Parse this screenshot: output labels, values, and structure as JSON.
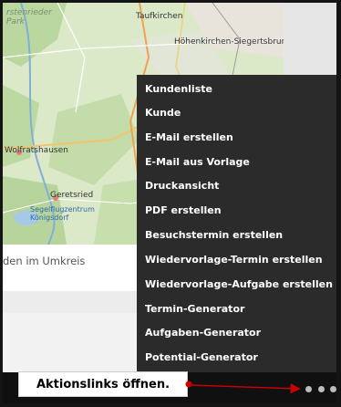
{
  "map": {
    "labels": {
      "park": "rstenrieder\nPark",
      "taufkirchen": "Taufkirchen",
      "hoehenkirchen": "Höhenkirchen-Siegertsbrunn",
      "wolfratshausen": "Wolfratshausen",
      "geretsried": "Geretsried",
      "segelflug": "Segelflugzentrum\nKönigsdorf"
    }
  },
  "card": {
    "caption": "den im Umkreis"
  },
  "menu": {
    "items": [
      "Kundenliste",
      "Kunde",
      "E-Mail erstellen",
      "E-Mail aus Vorlage",
      "Druckansicht",
      "PDF erstellen",
      "Besuchstermin erstellen",
      "Wiedervorlage-Termin erstellen",
      "Wiedervorlage-Aufgabe erstellen",
      "Termin-Generator",
      "Aufgaben-Generator",
      "Potential-Generator"
    ]
  },
  "tooltip": {
    "text": "Aktionslinks öffnen."
  },
  "icons": {
    "more": "more-dots-icon",
    "arrow": "red-arrow-icon"
  },
  "colors": {
    "menu_bg": "#2b2b2b",
    "menu_text": "#ffffff",
    "arrow": "#cc0000",
    "map_green": "#cfe3b7"
  }
}
